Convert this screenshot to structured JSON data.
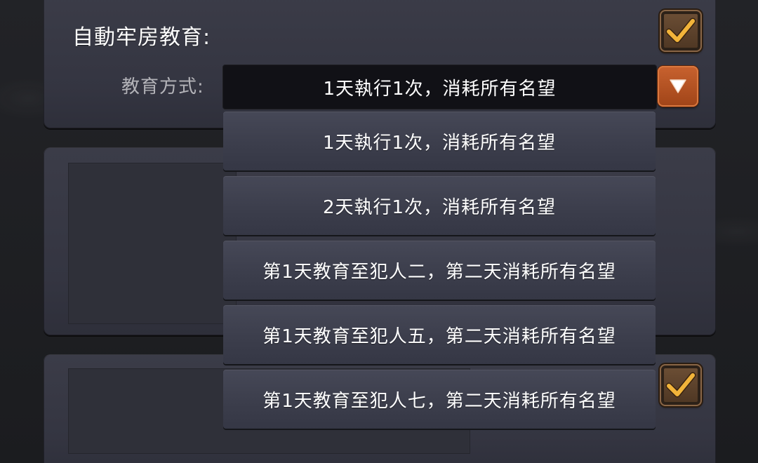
{
  "settings": {
    "auto_education": {
      "title": "自動牢房教育:",
      "checked": true
    },
    "education_method": {
      "label": "教育方式:",
      "selected": "1天執行1次，消耗所有名望",
      "options": [
        "1天執行1次，消耗所有名望",
        "2天執行1次，消耗所有名望",
        "第1天教育至犯人二，第二天消耗所有名望",
        "第1天教育至犯人五，第二天消耗所有名望",
        "第1天教育至犯人七，第二天消耗所有名望"
      ]
    },
    "second_checkbox": {
      "checked": true
    }
  },
  "icons": {
    "checkbox": "checkmark-icon",
    "dropdown": "triangle-down-icon"
  },
  "colors": {
    "check": "#f2b43a",
    "dropdown_button": "#c05a28",
    "panel": "#363743",
    "background": "#1f2023"
  }
}
